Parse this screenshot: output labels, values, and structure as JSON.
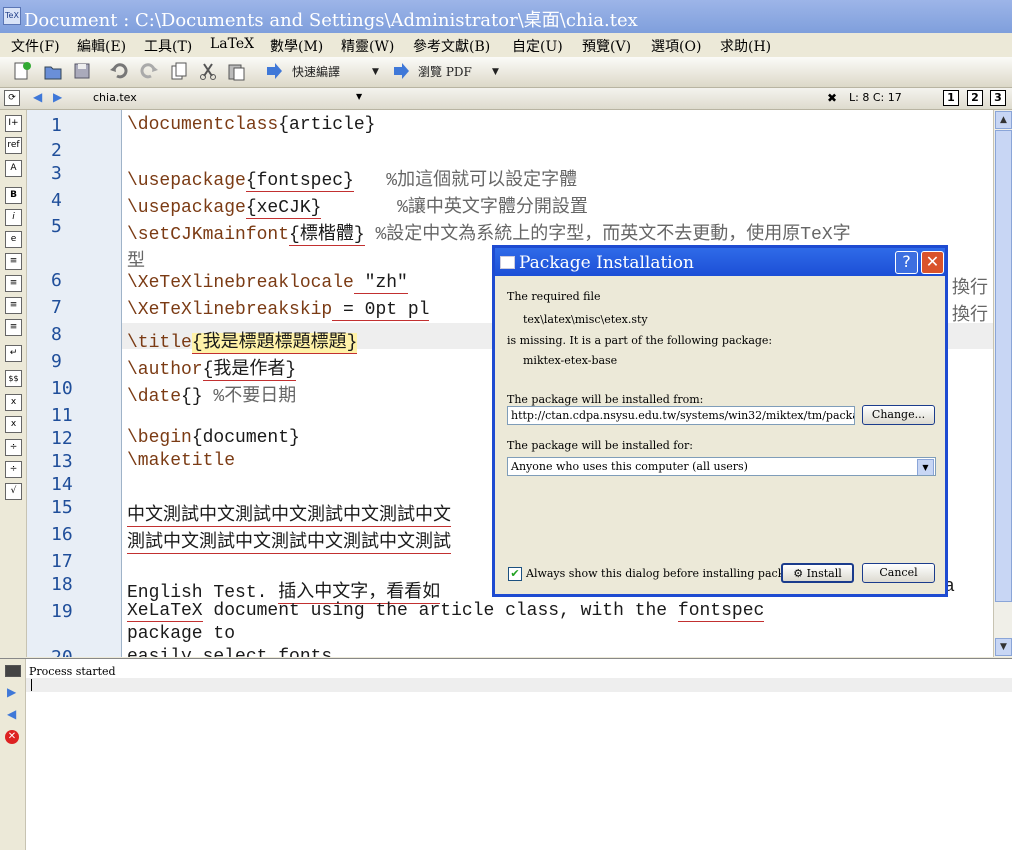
{
  "window": {
    "title": "Document : C:\\Documents and Settings\\Administrator\\桌面\\chia.tex",
    "app_icon": "TeX"
  },
  "menu": [
    "文件(F)",
    "編輯(E)",
    "工具(T)",
    "LaTeX",
    "數學(M)",
    "精靈(W)",
    "參考文獻(B)",
    "自定(U)",
    "預覽(V)",
    "選項(O)",
    "求助(H)"
  ],
  "toolbar": {
    "compile_label": "快速編譯",
    "preview_label": "瀏覽 PDF"
  },
  "tabbar": {
    "filename": "chia.tex",
    "cursor_pos": "L: 8 C: 17",
    "view_1": "1",
    "view_2": "2",
    "view_3": "3"
  },
  "left_icons": [
    "I+",
    "ref",
    "A",
    "B",
    "i",
    "e",
    "≡",
    "≡",
    "≡",
    "≡",
    "↵",
    "$$",
    "x",
    "x",
    "÷",
    "÷",
    "√"
  ],
  "editor": {
    "line_numbers": [
      "1",
      "2",
      "3",
      "4",
      "5",
      "6",
      "7",
      "8",
      "9",
      "10",
      "11",
      "12",
      "13",
      "14",
      "15",
      "16",
      "17",
      "18",
      "19",
      "20"
    ],
    "lines": [
      [
        "\\documentclass",
        "{article}",
        ""
      ],
      [
        "",
        "",
        ""
      ],
      [
        "\\usepackage",
        "{fontspec}",
        "   %加這個就可以設定字體"
      ],
      [
        "\\usepackage",
        "{xeCJK}",
        "       %讓中英文字體分開設置"
      ],
      [
        "\\setCJKmainfont",
        "{標楷體}",
        " %設定中文為系統上的字型，而英文不去更動，使用原TeX字"
      ],
      [
        "型",
        "",
        ""
      ],
      [
        "\\XeTeXlinebreaklocale",
        " \"zh\"",
        ""
      ],
      [
        "\\XeTeXlinebreakskip",
        " = 0pt pl",
        ""
      ],
      [
        "\\title",
        "{我是標題標題標題}",
        ""
      ],
      [
        "\\author",
        "{我是作者}",
        ""
      ],
      [
        "\\date",
        "{}",
        " %不要日期"
      ],
      [
        "",
        "",
        ""
      ],
      [
        "\\begin",
        "{document}",
        ""
      ],
      [
        "\\maketitle",
        "",
        ""
      ],
      [
        "",
        "",
        ""
      ],
      [
        "中文測試中文測試中文測試中文測試中文",
        "",
        ""
      ],
      [
        "測試中文測試中文測試中文測試中文測試",
        "",
        ""
      ],
      [
        "",
        "",
        ""
      ],
      [
        "English Test. ",
        "插入中文字，看看如",
        ""
      ],
      [
        "XeLaTeX",
        " document using the article class, with the ",
        "fontspec"
      ],
      [
        "package to",
        "",
        ""
      ],
      [
        "easily select fonts",
        "",
        ""
      ]
    ],
    "right_overflow_1": "換行",
    "right_overflow_2": "換行",
    "right_overflow_3": "a"
  },
  "bottom": {
    "status": "Process started"
  },
  "dialog": {
    "title": "Package Installation",
    "required_label": "The required file",
    "file": "tex\\latex\\misc\\etex.sty",
    "missing_label": "is missing. It is a part of the following package:",
    "package": "miktex-etex-base",
    "from_label": "The package will be installed from:",
    "url": "http://ctan.cdpa.nsysu.edu.tw/systems/win32/miktex/tm/packages/",
    "change_button": "Change...",
    "for_label": "The package will be installed for:",
    "for_value": "Anyone who uses this computer (all users)",
    "always_show": "Always show this dialog before installing packages",
    "always_checked": true,
    "install_button": "Install",
    "cancel_button": "Cancel",
    "help_glyph": "?",
    "close_glyph": "✕"
  }
}
